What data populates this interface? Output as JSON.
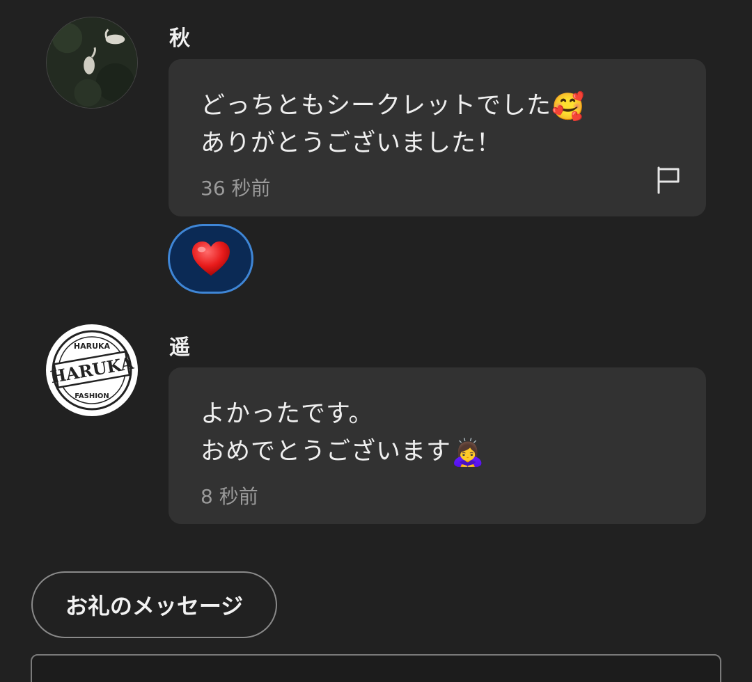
{
  "comments": [
    {
      "username": "秋",
      "avatar_icon": "swan-photo-avatar",
      "lines": [
        "どっちともシークレットでした",
        "ありがとうございました！"
      ],
      "emoji": "🥰",
      "timestamp": "36 秒前",
      "flag_icon": "flag-icon",
      "reaction": {
        "emoji": "❤️",
        "active": true
      }
    },
    {
      "username": "遥",
      "avatar_icon": "haruka-fashion-logo",
      "avatar_logo": {
        "top": "HARUKA",
        "main": "HARUKA",
        "bottom": "FASHION"
      },
      "lines": [
        "よかったです。",
        "おめでとうございます"
      ],
      "emoji": "🙇‍♀️",
      "timestamp": "8 秒前"
    }
  ],
  "thanks_button": {
    "label": "お礼のメッセージ"
  },
  "comment_input": {
    "placeholder": ""
  },
  "colors": {
    "background": "#212121",
    "bubble": "#323232",
    "reaction_bg": "#0b2a55",
    "reaction_border": "#3f86d6"
  }
}
